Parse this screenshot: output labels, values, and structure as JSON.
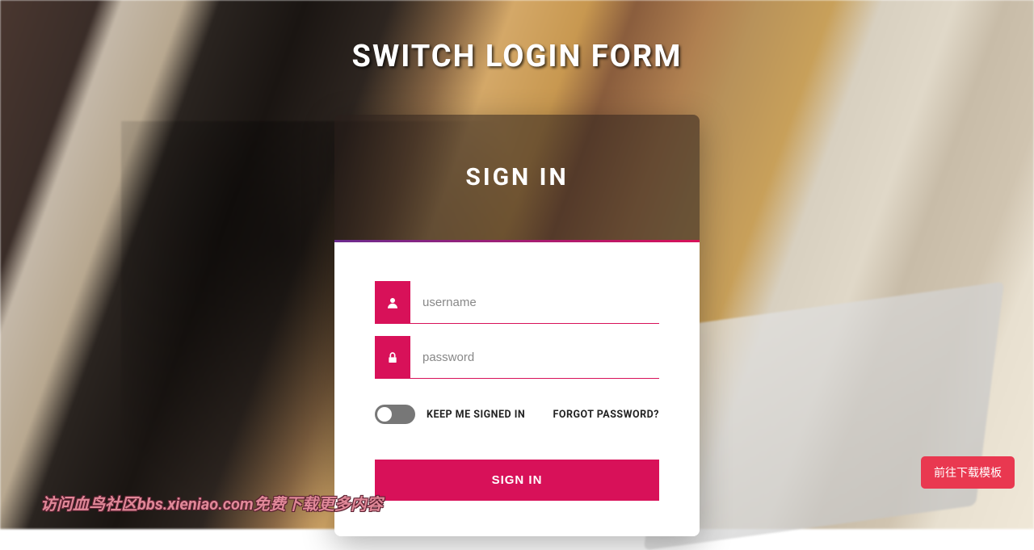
{
  "page": {
    "title": "SWITCH LOGIN FORM"
  },
  "card": {
    "header_title": "SIGN IN"
  },
  "form": {
    "username_placeholder": "username",
    "password_placeholder": "password",
    "keep_signed_label": "KEEP ME SIGNED IN",
    "forgot_password_label": "FORGOT PASSWORD?",
    "submit_label": "SIGN IN"
  },
  "watermark": {
    "text": "访问血鸟社区bbs.xieniao.com免费下载更多内容"
  },
  "download_button": {
    "label": "前往下载模板"
  },
  "colors": {
    "accent": "#d81159",
    "danger_button": "#e93850"
  },
  "icons": {
    "user": "user-icon",
    "lock": "lock-icon"
  }
}
